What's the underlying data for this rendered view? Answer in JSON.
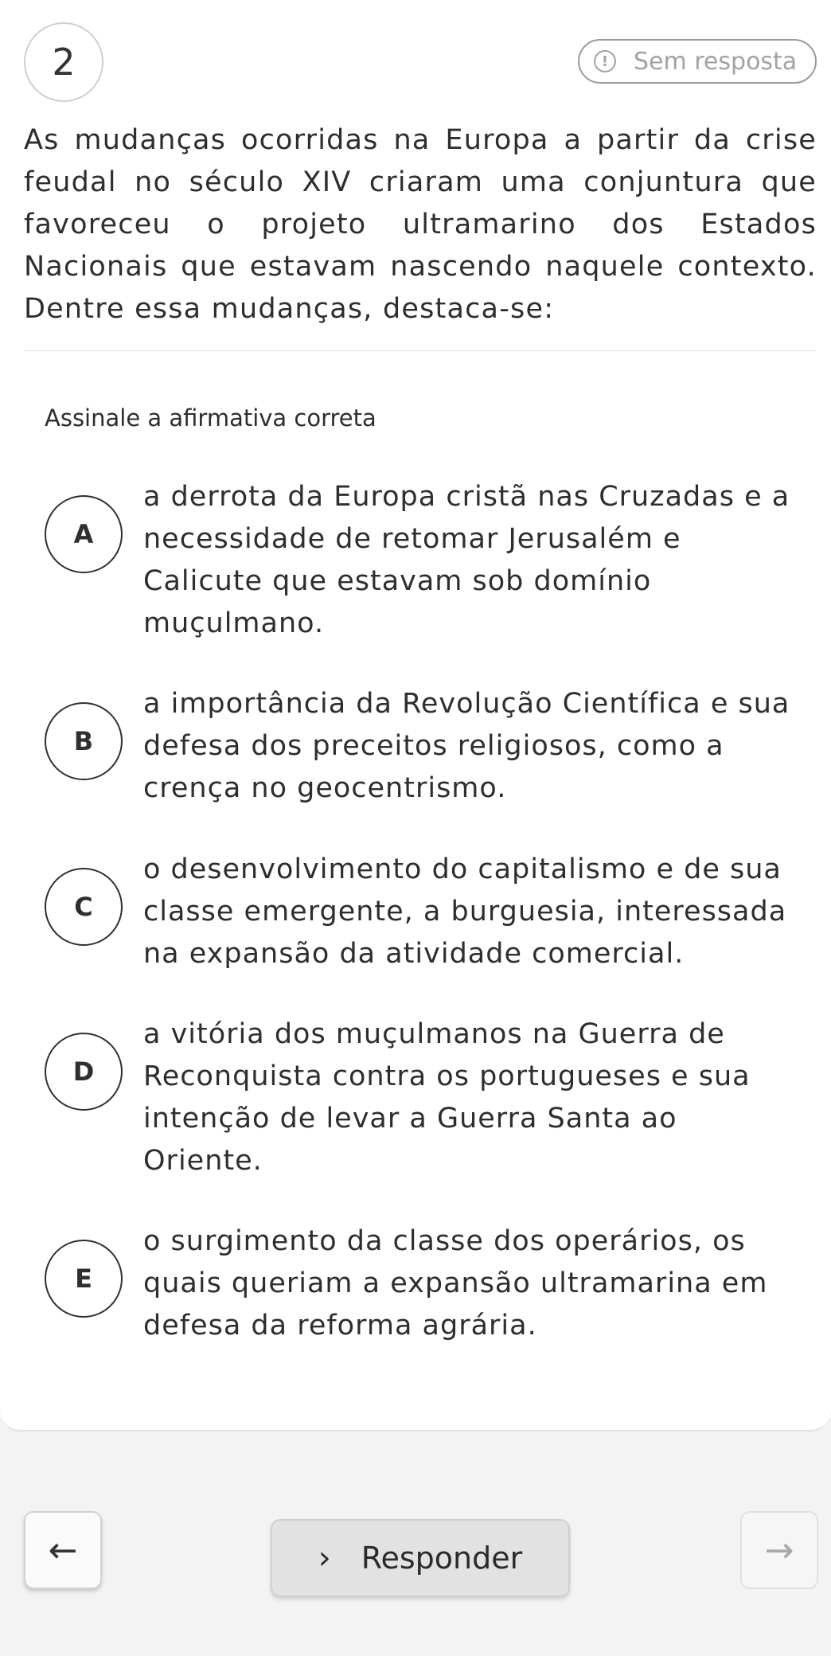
{
  "question": {
    "number": "2",
    "status_label": "Sem resposta",
    "status_icon": "exclamation-circle-icon",
    "text": "As mudanças ocorridas na Europa a partir da crise feudal no século XIV criaram uma conjuntura que favoreceu o projeto ultramarino dos Estados Nacionais que estavam nascendo naquele contexto. Dentre essa mudanças, destaca-se:",
    "instruction": "Assinale a afirmativa correta"
  },
  "options": [
    {
      "letter": "A",
      "text": "a derrota da Europa cristã nas Cruzadas e a necessidade de retomar Jerusalém e Calicute que estavam sob domínio muçulmano."
    },
    {
      "letter": "B",
      "text": "a importância da Revolução Científica e sua defesa dos preceitos religiosos, como a crença no geocentrismo."
    },
    {
      "letter": "C",
      "text": "o desenvolvimento do capitalismo e de sua classe emergente, a burguesia, interessada na expansão da atividade comercial."
    },
    {
      "letter": "D",
      "text": "a vitória dos muçulmanos na Guerra de Reconquista contra os portugueses e sua intenção de levar a Guerra Santa ao Oriente."
    },
    {
      "letter": "E",
      "text": "o surgimento da classe dos operários, os quais queriam a expansão ultramarina em defesa da reforma agrária."
    }
  ],
  "footer": {
    "back_icon": "arrow-left-icon",
    "respond_label": "Responder",
    "respond_icon": "chevron-right-icon",
    "next_icon": "arrow-right-icon"
  }
}
